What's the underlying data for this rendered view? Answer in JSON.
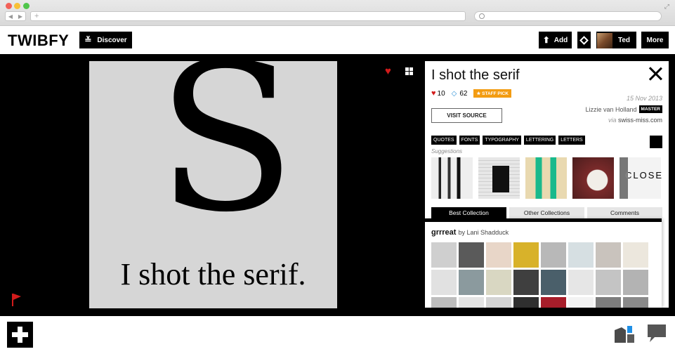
{
  "browser": {
    "address_plus": "+",
    "nav_back": "◀",
    "nav_fwd": "▶"
  },
  "header": {
    "logo": "TWIBFY",
    "discover_label": "Discover",
    "add_label": "Add",
    "user_name": "Ted",
    "more_label": "More"
  },
  "artwork": {
    "letter": "S",
    "caption": "I shot the serif."
  },
  "panel": {
    "title": "I shot the serif",
    "likes": "10",
    "reposts": "62",
    "badge": "STAFF PICK",
    "date": "15 Nov 2013",
    "visit_label": "VISIT SOURCE",
    "author": "Lizzie van Holland",
    "author_badge": "MASTER",
    "via_prefix": "via",
    "via_site": "swiss-miss.com",
    "tags": [
      "QUOTES",
      "FONTS",
      "TYPOGRAPHY",
      "LETTERING",
      "LETTERS"
    ],
    "suggestions_label": "Suggestions",
    "thumb5_text": "CLOSE",
    "tabs": [
      "Best Collection",
      "Other Collections",
      "Comments"
    ],
    "collection_name": "grrreat",
    "collection_by": "by Lani Shadduck",
    "mosaic_colors": [
      "#cfcfcf",
      "#5a5a5a",
      "#e8d6c8",
      "#d8b22a",
      "#b8b8b8",
      "#d6dfe2",
      "#c9c3bd",
      "#ece7dd",
      "#e1e1e1",
      "#8b9a9e",
      "#d9d7c2",
      "#3f3f3f",
      "#4a5f6a",
      "#e6e6e6",
      "#c4c4c4",
      "#b3b3b3",
      "#bdbdbd",
      "#e4e4e4",
      "#d4d4d4",
      "#2f2f2f",
      "#a71d2a",
      "#f3f3f3",
      "#7d7d7d",
      "#8a8a8a"
    ]
  }
}
